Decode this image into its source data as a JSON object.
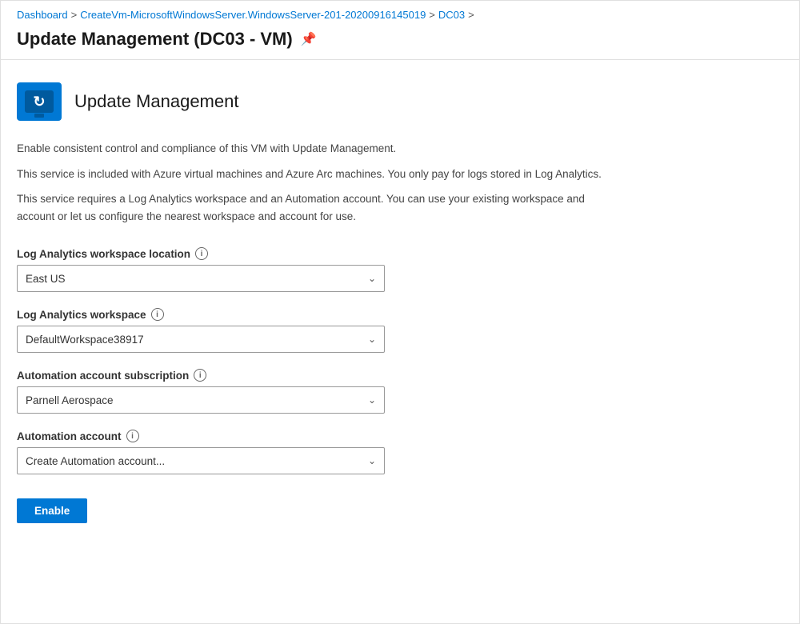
{
  "breadcrumb": {
    "items": [
      {
        "label": "Dashboard",
        "active": true
      },
      {
        "label": "CreateVm-MicrosoftWindowsServer.WindowsServer-201-20200916145019",
        "active": true
      },
      {
        "label": "DC03",
        "active": true
      }
    ],
    "separator": ">"
  },
  "page": {
    "title": "Update Management (DC03 - VM)",
    "pin_label": "📌"
  },
  "service": {
    "icon_label": "🔄",
    "name": "Update Management"
  },
  "descriptions": [
    "Enable consistent control and compliance of this VM with Update Management.",
    "This service is included with Azure virtual machines and Azure Arc machines. You only pay for logs stored in Log Analytics.",
    "This service requires a Log Analytics workspace and an Automation account. You can use your existing workspace and account or let us configure the nearest workspace and account for use."
  ],
  "fields": [
    {
      "id": "workspace-location",
      "label": "Log Analytics workspace location",
      "value": "East US",
      "info": "i"
    },
    {
      "id": "workspace",
      "label": "Log Analytics workspace",
      "value": "DefaultWorkspace38917",
      "info": "i"
    },
    {
      "id": "subscription",
      "label": "Automation account subscription",
      "value": "Parnell Aerospace",
      "info": "i"
    },
    {
      "id": "automation-account",
      "label": "Automation account",
      "value": "Create Automation account...",
      "info": "i"
    }
  ],
  "buttons": {
    "enable": "Enable"
  }
}
